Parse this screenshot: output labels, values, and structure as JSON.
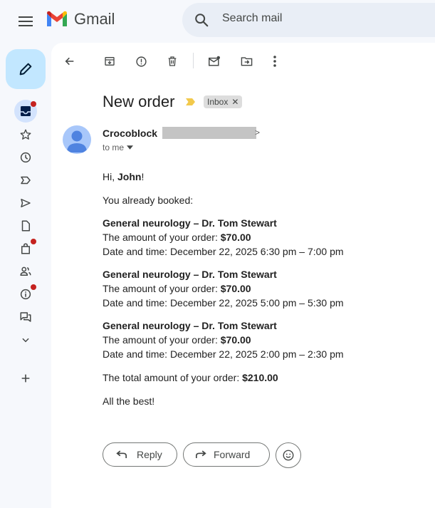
{
  "header": {
    "app_name": "Gmail",
    "search_placeholder": "Search mail"
  },
  "sidebar": {
    "items": [
      {
        "name": "inbox",
        "icon": "inbox-icon",
        "active": true,
        "notification": true
      },
      {
        "name": "starred",
        "icon": "star-icon"
      },
      {
        "name": "snoozed",
        "icon": "clock-icon"
      },
      {
        "name": "important",
        "icon": "label-important-icon"
      },
      {
        "name": "sent",
        "icon": "send-icon"
      },
      {
        "name": "drafts",
        "icon": "draft-icon"
      },
      {
        "name": "purchases",
        "icon": "shopping-bag-icon",
        "notification": true
      },
      {
        "name": "social",
        "icon": "people-icon"
      },
      {
        "name": "updates",
        "icon": "info-icon",
        "notification": true
      },
      {
        "name": "forums",
        "icon": "forum-icon"
      },
      {
        "name": "more",
        "icon": "chevron-down-icon"
      },
      {
        "name": "new-label",
        "icon": "plus-icon"
      }
    ]
  },
  "message": {
    "subject": "New order",
    "label": "Inbox",
    "sender_name": "Crocoblock",
    "recipient": "to me",
    "greeting_prefix": "Hi, ",
    "greeting_name": "John",
    "greeting_suffix": "!",
    "intro": "You already booked:",
    "bookings": [
      {
        "service": "General neurology – Dr. Tom Stewart",
        "amount_label": "The amount of your order: ",
        "amount": "$70.00",
        "datetime": "Date and time: December 22, 2025 6:30 pm – 7:00 pm"
      },
      {
        "service": "General neurology – Dr. Tom Stewart",
        "amount_label": "The amount of your order: ",
        "amount": "$70.00",
        "datetime": "Date and time: December 22, 2025 5:00 pm – 5:30 pm"
      },
      {
        "service": "General neurology – Dr. Tom Stewart",
        "amount_label": "The amount of your order: ",
        "amount": "$70.00",
        "datetime": "Date and time: December 22, 2025 2:00 pm – 2:30 pm"
      }
    ],
    "total_label": "The total amount of your order: ",
    "total": "$210.00",
    "signoff": "All the best!"
  },
  "actions": {
    "reply": "Reply",
    "forward": "Forward"
  },
  "colors": {
    "notification": "#c5221f",
    "compose_bg": "#c2e7ff",
    "important_marker": "#f2c94c"
  }
}
